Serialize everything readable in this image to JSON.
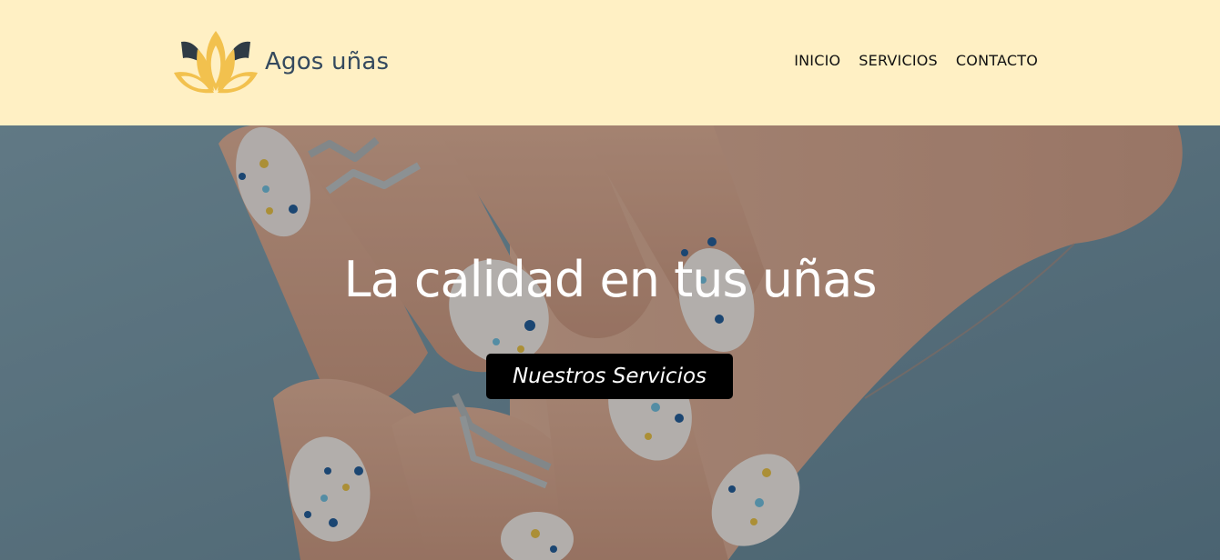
{
  "header": {
    "brand_name": "Agos uñas",
    "logo_icon": "lotus-icon",
    "nav": [
      {
        "label": "INICIO"
      },
      {
        "label": "SERVICIOS"
      },
      {
        "label": "CONTACTO"
      }
    ]
  },
  "hero": {
    "title": "La calidad en tus uñas",
    "cta_label": "Nuestros Servicios",
    "background_image": "manicured-hands-with-polka-dot-nails-and-rings"
  },
  "colors": {
    "header_bg": "#fff0c4",
    "brand_text": "#34495e",
    "logo_gold": "#f2c14e",
    "logo_dark": "#2f3b45",
    "hero_bg": "#6a8593",
    "cta_bg": "#000000"
  }
}
